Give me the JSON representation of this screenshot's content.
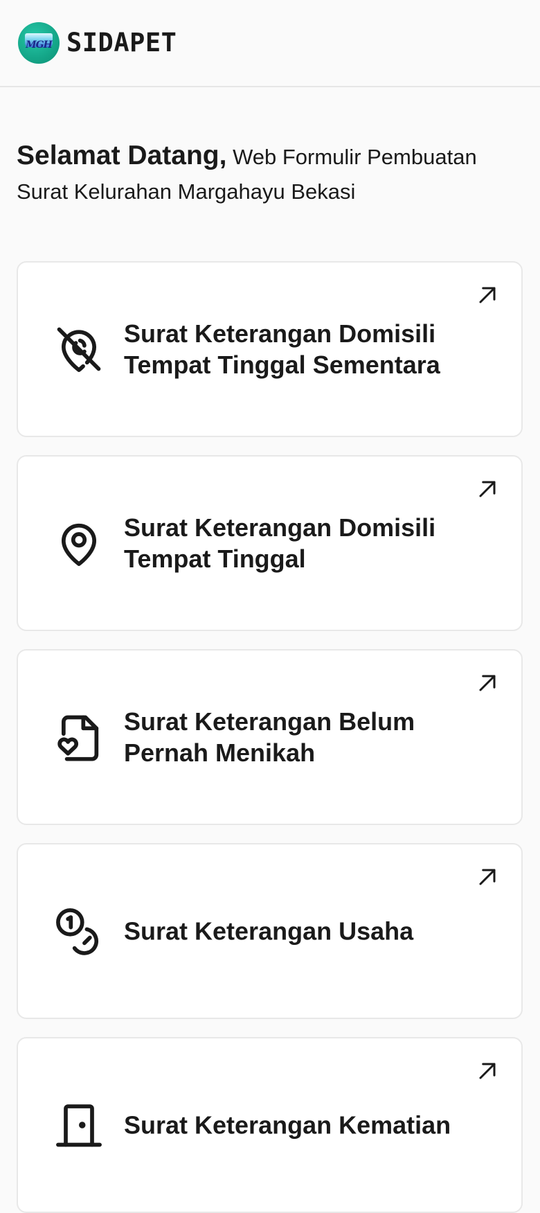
{
  "header": {
    "app_title": "SIDAPET",
    "logo_text": "MGH",
    "logo_icon": "mgh-logo-icon"
  },
  "welcome": {
    "heading": "Selamat Datang,",
    "subtitle": "Web Formulir Pembuatan Surat Kelurahan Margahayu Bekasi"
  },
  "cards": [
    {
      "label": "Surat Keterangan Domisili Tempat Tinggal Sementara",
      "icon": "map-pin-off-icon",
      "action_icon": "arrow-up-right-icon"
    },
    {
      "label": "Surat Keterangan Domisili Tempat Tinggal",
      "icon": "map-pin-icon",
      "action_icon": "arrow-up-right-icon"
    },
    {
      "label": "Surat Keterangan Belum Pernah Menikah",
      "icon": "file-heart-icon",
      "action_icon": "arrow-up-right-icon"
    },
    {
      "label": "Surat Keterangan Usaha",
      "icon": "coins-icon",
      "action_icon": "arrow-up-right-icon"
    },
    {
      "label": "Surat Keterangan Kematian",
      "icon": "door-icon",
      "action_icon": "arrow-up-right-icon"
    }
  ],
  "colors": {
    "background": "#fafafa",
    "card_background": "#ffffff",
    "card_border": "#e8e8e8",
    "text": "#1a1a1a",
    "logo_green": "#14a688"
  }
}
